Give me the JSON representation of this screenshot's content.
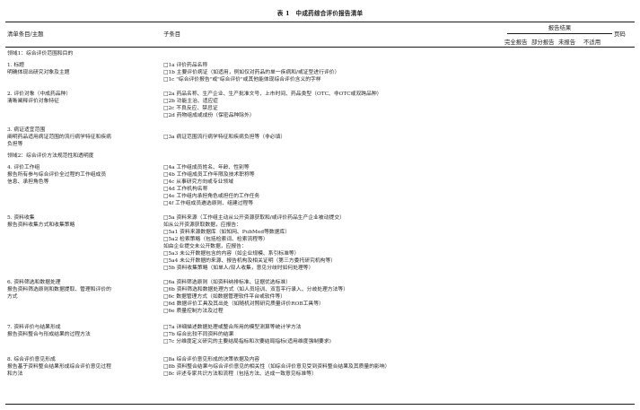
{
  "table_title": "表 1　中成药综合评价报告清单",
  "header": {
    "col1": "清单条目/主题",
    "col2": "子条目",
    "report_result": "报告结果",
    "page": "页码",
    "sub": [
      "完全报告",
      "部分报告",
      "未报告",
      "不适用"
    ]
  },
  "domain1": "领域1：综合评价范围和目的",
  "domain2": "领域2：综合评价方法规范性和透明度",
  "items": [
    {
      "title": "1. 标题",
      "desc": [
        "明确体现出研究对象及主题"
      ],
      "sub": [
        "□1a 评价药品名称",
        "□1b 主要评价病证（如适用，例如仅对药品的单一疾病和/或证型进行评价）",
        "□1c \"综合评价报告\"或\"综合评价\"或其他能体现综合评价含义的字样"
      ]
    },
    {
      "title": "2. 评价对象（中成药品种）",
      "desc": [
        "清晰阐释评价对象特征"
      ],
      "sub": [
        "□2a 药品名称、生产企业、生产批准文号、上市时间、药品类型（OTC、非OTC或双跨品种）",
        "□2b 功能主治、适应症",
        "□2c 不良反应、禁忌证",
        "□2d 药物组成或成份（保密品种除外）"
      ]
    },
    {
      "title": "3. 病证适宜范围",
      "desc": [
        "阐明药品适用病证范围的流行病学特征和疾病",
        "负担等"
      ],
      "sub": [
        "□3a 病证范围流行病学特征和疾病负担等（非必填）"
      ]
    },
    {
      "title": "4. 评价工作组",
      "desc": [
        "报告所有参与综合评价全过程的工作组成员",
        "信息、承担角色等"
      ],
      "sub": [
        "□4a 工作组成员姓名、年龄、性别等",
        "□4b 工作组成员工作年限及技术职称等",
        "□4c 从事研究方向或专业领域",
        "□4d 工作机构名称",
        "□4e 工作组内承担角色或担任的工作任务",
        "□4f 工作组成员遴选原则、组建过程等"
      ]
    },
    {
      "title": "5. 资料收集",
      "desc": [
        "报告资料收集方式和收集策略"
      ],
      "sub": [
        "□5a 资料来源（工作组主动从公开资源获取和/或评价药品生产企业被动提交）",
        "如从公开资源获取数据，应报告：",
        "□5a1 资料来源数据库（如知网、PubMed等数据库）",
        "□5a2 检索策略（包括检索词、检索流程等）",
        "如由企业提交未公开数据，应报告：",
        "□5a3 未公开数据包含的内容（如企业规模、系引标准等）",
        "□5a4 未公开数据的来源、报告机构及相关证明（第三方委托研究机构等）",
        "□5b 资料收集策略（如单人/双人收集，意见分歧时如何处理等）"
      ]
    },
    {
      "title": "6. 资料筛选和数据处理",
      "desc": [
        "报告资料筛选原则和数据提取、管理和评价的",
        "方式"
      ],
      "sub": [
        "□6a 资料筛选原则（如资料纳排标准、证据优选标准）",
        "□6b 资料筛选和数据处理方式（如人员培训、双盲平行录入、分歧处理方法等）",
        "□6c 数据管理方式（如数据管理软件平台或软件等）",
        "□6d 数据评价工具及其出处（如随机对照研究质量评价ROB工具等）",
        "□6e 质量控制方法及过程"
      ]
    },
    {
      "title": "7. 资料评价与结果形成",
      "desc": [
        "报告资料整合与形成结果的过程方法"
      ],
      "sub": [
        "□7a 详细描述数据处理或整合所用的模型测算等统计学方法",
        "□7b 综合比较不同资料的结果",
        "□7c 分维度定义研究的主要结局指标和次要结局指标(适用维度强制要求)"
      ]
    },
    {
      "title": "8. 综合评价意见形成",
      "desc": [
        "报告基于资料整合结果形成综合评价意见过程",
        "和方法"
      ],
      "sub": [
        "□8a 综合评价意见形成的决策依据及内容",
        "□8b 资料整合结果与综合评价意见的相关性（如综合评价意见受到资料整合结果及其质量的影响）",
        "□8c 评述专家共识方法和流程（包括方法、达成一致意见标准等）"
      ]
    }
  ]
}
